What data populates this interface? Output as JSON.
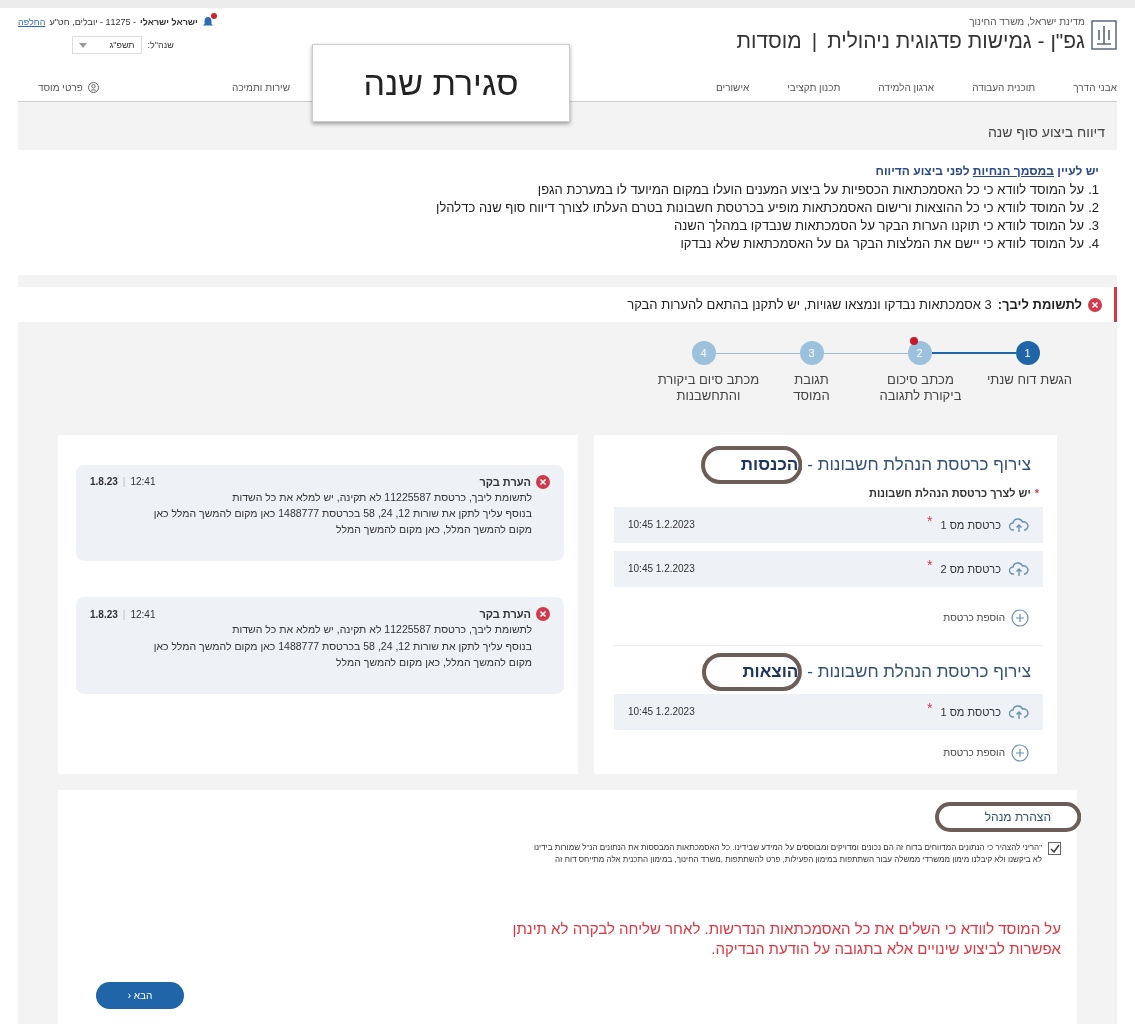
{
  "header": {
    "ministry": "מדינת ישראל, משרד החינוך",
    "app_title": "גפ\"ן - גמישות פדגוגית ניהולית",
    "section": "מוסדות",
    "separator": "|",
    "user_name": "ישראל ישראלי",
    "user_details": "- 11275 - יובלים, חט\"ע",
    "switch_link": "החלפה",
    "has_notification": true,
    "year_label": "שנה\"ל:",
    "year_value": "תשפ\"ג"
  },
  "nav": [
    {
      "label": "אבני הדרך"
    },
    {
      "label": "תוכנית העבודה"
    },
    {
      "label": "ארגון הלמידה"
    },
    {
      "label": "תכנון תקציבי"
    },
    {
      "label": "אישורים"
    },
    {
      "label": "שירות ותמיכה"
    }
  ],
  "institution_link": "פרטי מוסד",
  "callout": "סגירת שנה",
  "page_title": "דיווח ביצוע סוף שנה",
  "instructions": {
    "intro": "יש לעיין ",
    "intro_link": "במסמך הנחיות",
    "intro_end": " לפני ביצוע הדיווח",
    "items": [
      {
        "number": "1.",
        "text": "על המוסד לוודא כי כל האסמכתאות הכספיות על ביצוע המענים הועלו במקום המיועד לו במערכת הגפן"
      },
      {
        "number": "2.",
        "text": "על המוסד לוודא כי כל ההוצאות ורישום האסמכתאות מופיע בכרטסת חשבונות בטרם העלתו לצורך דיווח סוף שנה כדלהלן"
      },
      {
        "number": "3.",
        "text": "על המוסד לוודא כי תוקנו הערות הבקר על הסמכתאות שנבדקו במהלך השנה"
      },
      {
        "number": "4.",
        "text": "על המוסד לוודא כי יישם את המלצות הבקר גם על האסמכתאות שלא נבדקו"
      }
    ]
  },
  "alert": {
    "label": "לתשומת ליבך:",
    "text": "3 אסמכתאות נבדקו ונמצאו שגויות, יש לתקנן בהתאם להערות הבקר"
  },
  "stepper": [
    {
      "number": "1",
      "label": "הגשת דוח שנתי",
      "selected": true,
      "badge": false
    },
    {
      "number": "2",
      "label": "מכתב סיכום ביקורת לתגובה",
      "selected": false,
      "badge": true
    },
    {
      "number": "3",
      "label": "תגובת המוסד",
      "selected": false,
      "badge": false
    },
    {
      "number": "4",
      "label": "מכתב סיום ביקורת והתחשבנות",
      "selected": false,
      "badge": false
    }
  ],
  "upload_sections": [
    {
      "title": "צירוף כרטסת הנהלת חשבונות -",
      "title_emphasis": "הכנסות",
      "note_mark": "*",
      "note": "יש לצרך כרטסת הנהלת חשבונות",
      "files": [
        {
          "name": "כרטסת מס 1",
          "required": true,
          "required_mark": "*",
          "timestamp": "1.2.2023 10:45"
        },
        {
          "name": "כרטסת מס 2",
          "required": true,
          "required_mark": "*",
          "timestamp": "1.2.2023 10:45"
        }
      ],
      "add_label": "הוספת כרטסת"
    },
    {
      "title": "צירוף כרטסת הנהלת חשבונות -",
      "title_emphasis": "הוצאות",
      "files": [
        {
          "name": "כרטסת מס 1",
          "required": true,
          "required_mark": "*",
          "timestamp": "1.2.2023 10:45"
        }
      ],
      "add_label": "הוספת כרטסת"
    }
  ],
  "comments": [
    {
      "title": "הערת בקר",
      "time": "12:41",
      "separator": "|",
      "date": "1.8.23",
      "lines": [
        "לתשומת ליבך, כרטסת 11225587 לא תקינה, יש למלא את כל השדות",
        "בנוסף עליך לתקן את שורות 12, 24, 58 בכרטסת 1488777  כאן מקום להמשך המלל כאן",
        "מקום להמשך המלל, כאן מקום להמשך המלל"
      ]
    },
    {
      "title": "הערת בקר",
      "time": "12:41",
      "separator": "|",
      "date": "1.8.23",
      "lines": [
        "לתשומת ליבך, כרטסת 11225587 לא תקינה, יש למלא את כל השדות",
        "בנוסף עליך לתקן את שורות 12, 24, 58 בכרטסת 1488777  כאן מקום להמשך המלל כאן",
        "מקום להמשך המלל, כאן מקום להמשך המלל"
      ]
    }
  ],
  "declaration": {
    "title": "הצהרת מנהל",
    "checked": true,
    "lines": [
      "\"הריני להצהיר כי הנתונים המדווחים בדוח זה הם נכונים ומדויקים ומבוססים על המידע שבידינו. כל האסמכתאות המבססות את הנתונים הנ\"ל שמורות בידינו",
      "לא ביקשנו ולא קיבלנו מימון ממשרדי ממשלה עבור השתתפות במימון הפעילות, פרט להשתתפות ,משרד החינוך, במימון התכנית אלה מתייחס דוח זה"
    ]
  },
  "warning_lines": [
    "על המוסד לוודא כי השלים את כל האסמכתאות הנדרשות. לאחר שליחה לבקרה לא תינתן",
    "אפשרות לביצוע שינויים אלא בתגובה על הודעת הבדיקה."
  ],
  "next_button": "הבא ‹"
}
